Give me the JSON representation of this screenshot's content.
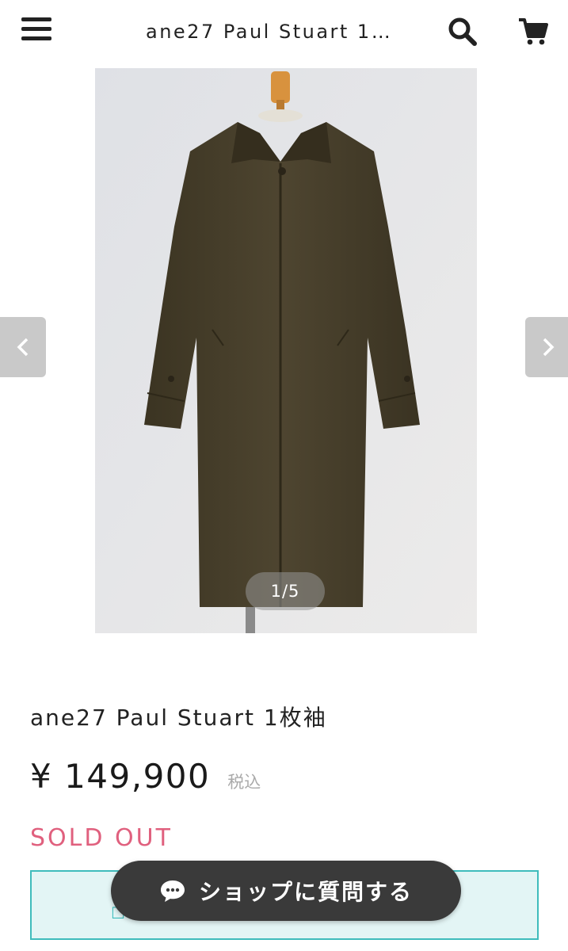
{
  "header": {
    "menu_icon": "hamburger-menu-icon",
    "title": "ane27 Paul Stuart 1…",
    "search_icon": "search-icon",
    "cart_icon": "cart-icon"
  },
  "carousel": {
    "image_alt": "Dark olive-brown wool single-breasted coat on a dress form",
    "prev_icon": "chevron-left-icon",
    "next_icon": "chevron-right-icon",
    "counter": "1/5"
  },
  "product": {
    "name": "ane27 Paul Stuart 1枚袖",
    "price": "¥ 149,900",
    "tax_label": "税込",
    "status": "SOLD OUT"
  },
  "chat_button": {
    "icon": "chat-bubble-icon",
    "label": "ショップに質問する"
  },
  "colors": {
    "sold_out": "#e0607e",
    "teal_border": "#3fbcbc",
    "teal_fill": "#e3f5f5",
    "chat_button_bg": "#3a3a3a"
  }
}
